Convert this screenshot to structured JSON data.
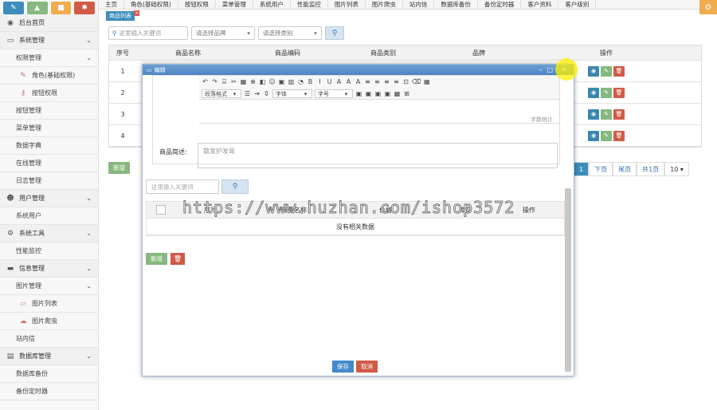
{
  "sidebar": {
    "top_buttons": [
      {
        "icon": "pencil-icon",
        "glyph": "✎",
        "color": "#3c8dbc"
      },
      {
        "icon": "chart-icon",
        "glyph": "▲",
        "color": "#87b87f"
      },
      {
        "icon": "folder-icon",
        "glyph": "■",
        "color": "#f0ad4e"
      },
      {
        "icon": "settings-icon",
        "glyph": "✱",
        "color": "#d15b47"
      }
    ],
    "items": [
      {
        "label": "后台首页",
        "icon": "dashboard-icon",
        "glyph": "◉",
        "level": 0
      },
      {
        "label": "系统管理",
        "icon": "monitor-icon",
        "glyph": "▭",
        "level": 0,
        "chev": "⌄"
      },
      {
        "label": "权限管理",
        "level": 1,
        "chev": "⌄"
      },
      {
        "label": "角色(基础权限)",
        "icon": "wrench-icon",
        "glyph": "✎",
        "level": 2
      },
      {
        "label": "按钮权限",
        "icon": "key-icon",
        "glyph": "⚷",
        "level": 2
      },
      {
        "label": "按钮管理",
        "level": 1
      },
      {
        "label": "菜单管理",
        "level": 1
      },
      {
        "label": "数据字典",
        "level": 1
      },
      {
        "label": "在线管理",
        "level": 1
      },
      {
        "label": "日志管理",
        "level": 1
      },
      {
        "label": "用户管理",
        "icon": "users-icon",
        "glyph": "☻",
        "level": 0,
        "chev": "⌄"
      },
      {
        "label": "系统用户",
        "level": 1
      },
      {
        "label": "系统工具",
        "icon": "gear-icon",
        "glyph": "⚙",
        "level": 0,
        "chev": "⌄"
      },
      {
        "label": "性能监控",
        "level": 1
      },
      {
        "label": "信息管理",
        "icon": "card-icon",
        "glyph": "▬",
        "level": 0,
        "chev": "⌄"
      },
      {
        "label": "图片管理",
        "level": 1,
        "chev": "⌄"
      },
      {
        "label": "图片列表",
        "icon": "folder-open-icon",
        "glyph": "▱",
        "level": 2
      },
      {
        "label": "图片爬虫",
        "icon": "cloud-icon",
        "glyph": "☁",
        "level": 2
      },
      {
        "label": "站内信",
        "level": 1
      },
      {
        "label": "数据库管理",
        "icon": "database-icon",
        "glyph": "▤",
        "level": 0,
        "chev": "⌄"
      },
      {
        "label": "数据库备份",
        "level": 1
      },
      {
        "label": "备份定时器",
        "level": 1
      }
    ]
  },
  "tabs": [
    "主页",
    "角色(基础权限)",
    "按钮权限",
    "菜单管理",
    "系统用户",
    "性能监控",
    "图片列表",
    "图片爬虫",
    "站内信",
    "数据库备份",
    "备份定时器",
    "客户资料",
    "客户级别"
  ],
  "subtab": "商品列表",
  "filters": {
    "search_placeholder": "这里输入关键词",
    "brand": "请选择品牌",
    "category": "请选择类别"
  },
  "table": {
    "headers": [
      "序号",
      "商品名称",
      "商品编码",
      "商品类别",
      "品牌",
      "操作"
    ],
    "rows": [
      "1",
      "2",
      "3",
      "4"
    ]
  },
  "add_button": "新增",
  "pager": [
    "1",
    "下页",
    "尾页",
    "共1页",
    "10"
  ],
  "modal": {
    "title": "编辑",
    "toolbar_row1": [
      "↶",
      "↷",
      "⌸",
      "✂",
      "▦",
      "⊕",
      "◧",
      "☺",
      "▣",
      "▥",
      "◔",
      "B",
      "I",
      "U",
      "A",
      "A",
      "A",
      "≡",
      "≡",
      "≡",
      "≡",
      "⊡",
      "⌫",
      "▦"
    ],
    "format_label": "段落格式",
    "font_label": "字体",
    "size_label": "字号",
    "word_count": "字数统计",
    "desc_label": "商品简述:",
    "desc_value": "散发护发膏",
    "search_placeholder": "这里输入关键词",
    "sub_headers": [
      "序号",
      "商品名称",
      "价格",
      "库存",
      "操作"
    ],
    "empty_text": "没有相关数据",
    "add": "新增",
    "save": "保存",
    "cancel": "取消"
  },
  "watermark": "https://www.huzhan.com/ishop3572"
}
